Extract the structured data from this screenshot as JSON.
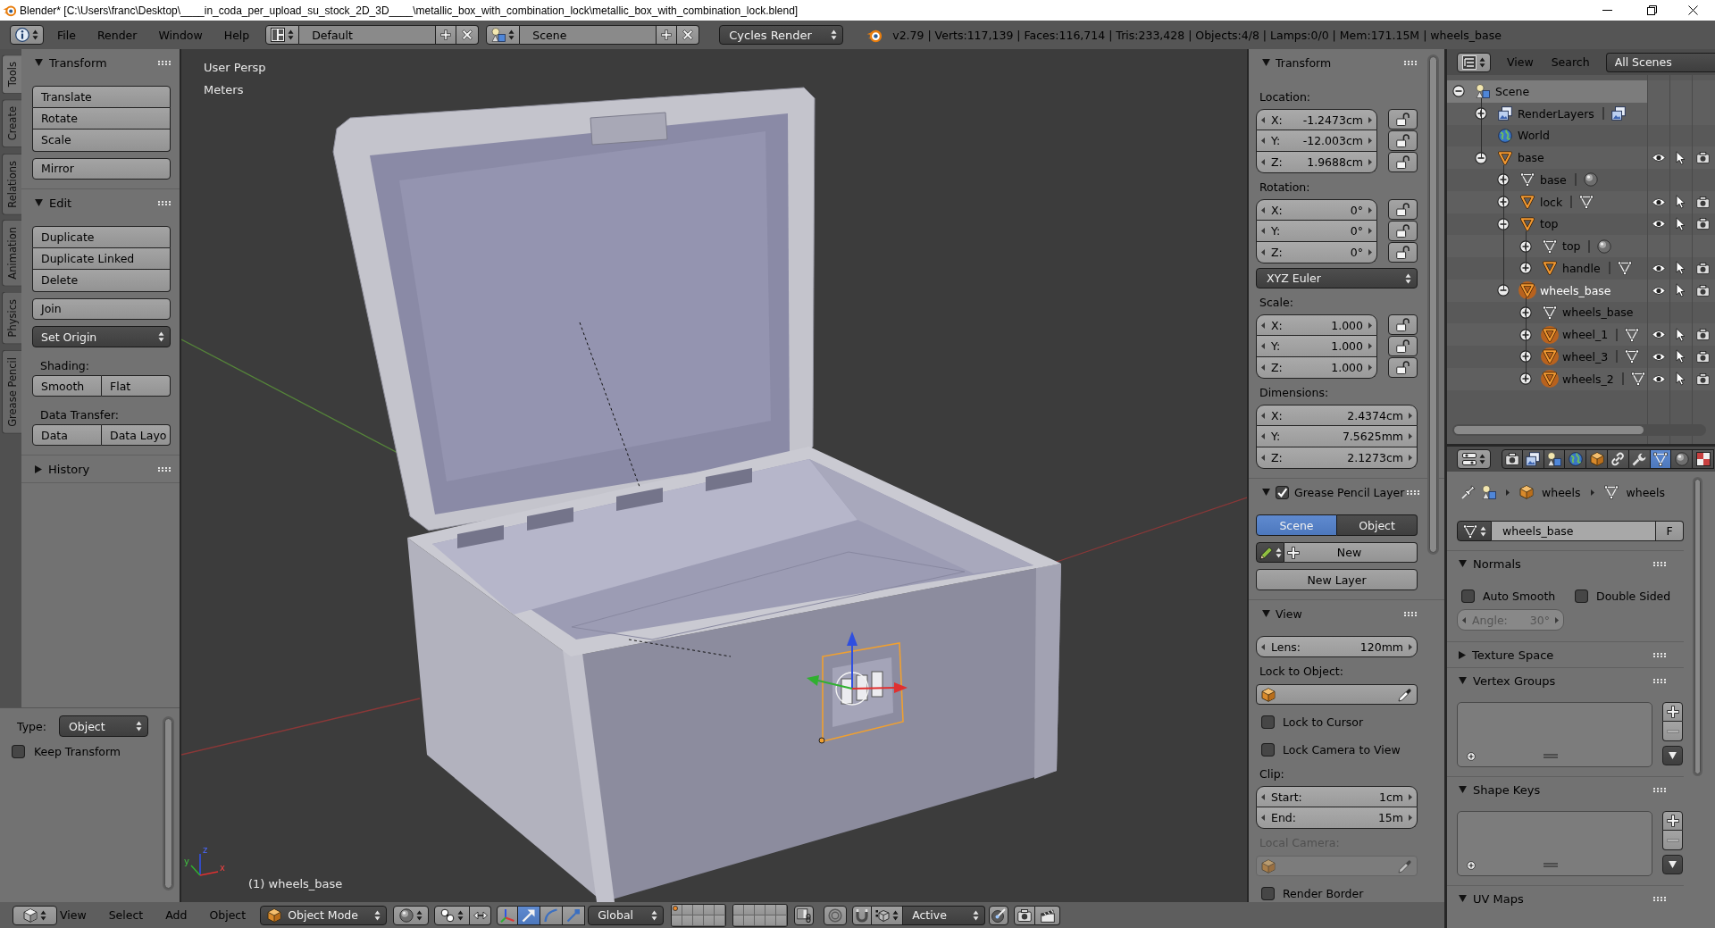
{
  "title_bar": {
    "title": "Blender* [C:\\Users\\franc\\Desktop\\____in_coda_per_upload_su_stock_2D_3D____\\metallic_box_with_combination_lock\\metallic_box_with_combination_lock.blend]"
  },
  "info_header": {
    "menus": [
      "File",
      "Render",
      "Window",
      "Help"
    ],
    "screen_layout": "Default",
    "scene": "Scene",
    "render_engine": "Cycles Render",
    "stats": "v2.79 | Verts:117,139 | Faces:116,714 | Tris:233,428 | Objects:4/8 | Lamps:0/0 | Mem:171.15M | wheels_base"
  },
  "tool_shelf": {
    "tabs": [
      {
        "label": "Tools",
        "selected": true
      },
      {
        "label": "Create",
        "selected": false
      },
      {
        "label": "Relations",
        "selected": false
      },
      {
        "label": "Animation",
        "selected": false
      },
      {
        "label": "Physics",
        "selected": false
      },
      {
        "label": "Grease Pencil",
        "selected": false
      }
    ],
    "panels": [
      {
        "title": "Transform",
        "expanded": true,
        "items": [
          {
            "kind": "buttons",
            "labels": [
              "Translate",
              "Rotate",
              "Scale"
            ]
          },
          {
            "kind": "buttons",
            "labels": [
              "Mirror"
            ]
          }
        ]
      },
      {
        "title": "Edit",
        "expanded": true,
        "items": [
          {
            "kind": "buttons",
            "labels": [
              "Duplicate",
              "Duplicate Linked",
              "Delete"
            ]
          },
          {
            "kind": "buttons",
            "labels": [
              "Join"
            ]
          },
          {
            "kind": "dropdown",
            "value": "Set Origin"
          },
          {
            "kind": "label",
            "text": "Shading:"
          },
          {
            "kind": "row",
            "labels": [
              "Smooth",
              "Flat"
            ]
          },
          {
            "kind": "label",
            "text": "Data Transfer:"
          },
          {
            "kind": "row",
            "labels": [
              "Data",
              "Data Layo"
            ]
          }
        ]
      },
      {
        "title": "History",
        "expanded": false
      }
    ]
  },
  "operator_panel": {
    "type_label": "Type:",
    "type_value": "Object",
    "checkboxes": [
      {
        "label": "Keep Transform",
        "checked": false
      }
    ]
  },
  "viewport": {
    "view_name": "User Persp",
    "units": "Meters",
    "axis_labels": [
      "z",
      "y",
      "x"
    ],
    "object_info": "(1) wheels_base"
  },
  "properties_region": {
    "panels": [
      {
        "title": "Transform",
        "expanded": true,
        "items": [
          {
            "kind": "label",
            "text": "Location:"
          },
          {
            "kind": "vector",
            "fields": [
              {
                "name": "X:",
                "value": "-1.2473cm",
                "locked": false
              },
              {
                "name": "Y:",
                "value": "-12.003cm",
                "locked": false
              },
              {
                "name": "Z:",
                "value": "1.9688cm",
                "locked": false
              }
            ]
          },
          {
            "kind": "label",
            "text": "Rotation:"
          },
          {
            "kind": "vector",
            "fields": [
              {
                "name": "X:",
                "value": "0°",
                "locked": false
              },
              {
                "name": "Y:",
                "value": "0°",
                "locked": false
              },
              {
                "name": "Z:",
                "value": "0°",
                "locked": false
              }
            ]
          },
          {
            "kind": "dropdown",
            "value": "XYZ Euler"
          },
          {
            "kind": "label",
            "text": "Scale:"
          },
          {
            "kind": "vector",
            "fields": [
              {
                "name": "X:",
                "value": "1.000",
                "locked": false
              },
              {
                "name": "Y:",
                "value": "1.000",
                "locked": false
              },
              {
                "name": "Z:",
                "value": "1.000",
                "locked": false
              }
            ]
          },
          {
            "kind": "label",
            "text": "Dimensions:"
          },
          {
            "kind": "vector",
            "fields": [
              {
                "name": "X:",
                "value": "2.4374cm"
              },
              {
                "name": "Y:",
                "value": "7.5625mm"
              },
              {
                "name": "Z:",
                "value": "2.1273cm"
              }
            ]
          }
        ]
      },
      {
        "title": "Grease Pencil Layer",
        "expanded": true,
        "checked": true,
        "items": [
          {
            "kind": "radio",
            "options": [
              {
                "label": "Scene",
                "selected": true
              },
              {
                "label": "Object",
                "selected": false
              }
            ]
          },
          {
            "kind": "new_row",
            "label": "New"
          },
          {
            "kind": "button",
            "label": "New Layer"
          }
        ]
      },
      {
        "title": "View",
        "expanded": true,
        "items": [
          {
            "kind": "number",
            "name": "Lens:",
            "value": "120mm",
            "disabled": false
          },
          {
            "kind": "label",
            "text": "Lock to Object:",
            "disabled": false
          },
          {
            "kind": "object_field",
            "disabled": false
          },
          {
            "kind": "checkbox",
            "label": "Lock to Cursor",
            "checked": false
          },
          {
            "kind": "checkbox",
            "label": "Lock Camera to View",
            "checked": false
          },
          {
            "kind": "label",
            "text": "Clip:",
            "disabled": false
          },
          {
            "kind": "vector",
            "fields": [
              {
                "name": "Start:",
                "value": "1cm"
              },
              {
                "name": "End:",
                "value": "15m"
              }
            ]
          },
          {
            "kind": "label",
            "text": "Local Camera:",
            "disabled": true
          },
          {
            "kind": "object_field",
            "disabled": true
          },
          {
            "kind": "checkbox",
            "label": "Render Border",
            "checked": false
          }
        ]
      }
    ]
  },
  "outliner": {
    "menus": [
      "View",
      "Search"
    ],
    "filter": "All Scenes",
    "tree": [
      {
        "kind": "scene",
        "name": "Scene",
        "expanded": true,
        "highlighted": true,
        "selected": false,
        "active": false,
        "children": [
          {
            "kind": "render_layers",
            "name": "RenderLayers",
            "expanded": false,
            "highlighted": false,
            "selected": false,
            "active": false,
            "data_block": {
              "kind": "render_layer"
            }
          },
          {
            "kind": "world",
            "name": "World",
            "highlighted": false,
            "selected": false,
            "active": false
          },
          {
            "kind": "object",
            "name": "base",
            "expanded": true,
            "highlighted": false,
            "selected": false,
            "active": false,
            "children": [
              {
                "kind": "mesh",
                "name": "base",
                "expanded": false,
                "highlighted": false,
                "selected": false,
                "active": false,
                "data_block": {
                  "kind": "material"
                }
              },
              {
                "kind": "object",
                "name": "lock",
                "expanded": false,
                "highlighted": false,
                "selected": false,
                "active": false,
                "data_block": {
                  "kind": "mesh"
                }
              },
              {
                "kind": "object",
                "name": "top",
                "expanded": true,
                "highlighted": false,
                "selected": false,
                "active": false,
                "children": [
                  {
                    "kind": "mesh",
                    "name": "top",
                    "expanded": false,
                    "highlighted": false,
                    "selected": false,
                    "active": false,
                    "data_block": {
                      "kind": "material"
                    }
                  },
                  {
                    "kind": "object",
                    "name": "handle",
                    "expanded": false,
                    "highlighted": false,
                    "selected": false,
                    "active": false,
                    "data_block": {
                      "kind": "mesh"
                    }
                  }
                ]
              },
              {
                "kind": "object",
                "name": "wheels_base",
                "expanded": true,
                "highlighted": false,
                "selected": true,
                "active": true,
                "children": [
                  {
                    "kind": "mesh",
                    "name": "wheels_base",
                    "expanded": false,
                    "highlighted": false,
                    "selected": false,
                    "active": false
                  },
                  {
                    "kind": "object",
                    "name": "wheel_1",
                    "expanded": false,
                    "highlighted": false,
                    "selected": true,
                    "active": false,
                    "data_block": {
                      "kind": "mesh"
                    }
                  },
                  {
                    "kind": "object",
                    "name": "wheel_3",
                    "expanded": false,
                    "highlighted": false,
                    "selected": true,
                    "active": false,
                    "data_block": {
                      "kind": "mesh"
                    }
                  },
                  {
                    "kind": "object",
                    "name": "wheels_2",
                    "expanded": false,
                    "highlighted": false,
                    "selected": true,
                    "active": false,
                    "data_block": {
                      "kind": "mesh"
                    }
                  }
                ]
              }
            ]
          }
        ]
      }
    ]
  },
  "properties_editor": {
    "tabs": [
      {
        "kind": "render",
        "selected": false
      },
      {
        "kind": "render_layers",
        "selected": false
      },
      {
        "kind": "scene",
        "selected": false
      },
      {
        "kind": "world",
        "selected": false
      },
      {
        "kind": "object",
        "selected": false
      },
      {
        "kind": "constraints",
        "selected": false
      },
      {
        "kind": "modifiers",
        "selected": false
      },
      {
        "kind": "data",
        "selected": true
      },
      {
        "kind": "material",
        "selected": false
      },
      {
        "kind": "texture",
        "selected": false
      }
    ],
    "breadcrumb": [
      {
        "kind": "object",
        "name": "wheels"
      },
      {
        "kind": "mesh",
        "name": "wheels"
      }
    ],
    "datablock": {
      "name": "wheels_base",
      "fake_user": "F"
    },
    "panels": [
      {
        "title": "Normals",
        "expanded": true,
        "items": [
          {
            "kind": "checkboxes",
            "options": [
              {
                "label": "Auto Smooth",
                "checked": false
              },
              {
                "label": "Double Sided",
                "checked": false
              }
            ]
          },
          {
            "kind": "number",
            "name": "Angle:",
            "value": "30°",
            "disabled": true
          }
        ]
      },
      {
        "title": "Texture Space",
        "expanded": false
      },
      {
        "title": "Vertex Groups",
        "expanded": true,
        "items": [
          {
            "kind": "list"
          }
        ]
      },
      {
        "title": "Shape Keys",
        "expanded": true,
        "items": [
          {
            "kind": "list"
          }
        ]
      },
      {
        "title": "UV Maps",
        "expanded": true
      }
    ]
  },
  "view3d_header": {
    "menus": [
      "View",
      "Select",
      "Add",
      "Object"
    ],
    "mode": "Object Mode",
    "manipulators": [
      {
        "kind": "translate",
        "selected": true
      },
      {
        "kind": "rotate",
        "selected": false
      },
      {
        "kind": "scale",
        "selected": false
      }
    ],
    "orientation": "Global",
    "layers": [
      {
        "has_objects": true
      },
      {
        "has_objects": false
      },
      {
        "has_objects": false
      },
      {
        "has_objects": false
      },
      {
        "has_objects": false
      },
      {
        "has_objects": false
      },
      {
        "has_objects": false
      },
      {
        "has_objects": false
      },
      {
        "has_objects": false
      },
      {
        "has_objects": false
      },
      {
        "has_objects": false
      },
      {
        "has_objects": false
      },
      {
        "has_objects": false
      },
      {
        "has_objects": false
      },
      {
        "has_objects": false
      },
      {
        "has_objects": false
      },
      {
        "has_objects": false
      },
      {
        "has_objects": false
      },
      {
        "has_objects": false
      },
      {
        "has_objects": false
      }
    ],
    "snap_target": "Active"
  }
}
